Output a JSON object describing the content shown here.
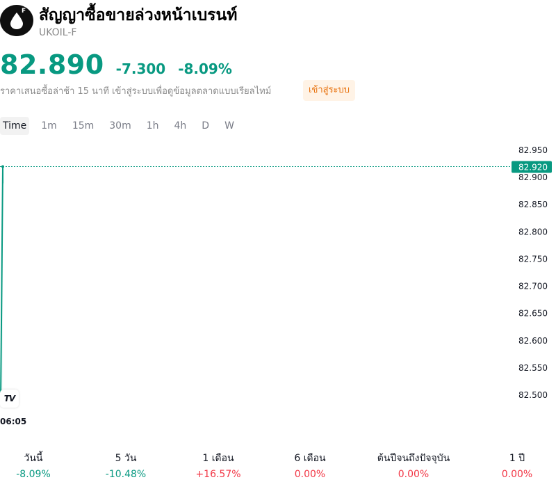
{
  "header": {
    "logo_badge": "F",
    "title": "สัญญาซื้อขายล่วงหน้าเบรนท์",
    "ticker": "UKOIL-F",
    "price": "82.890",
    "change": "-7.300",
    "change_pct": "-8.09%",
    "notice": "ราคาเสนอซื้อล่าช้า 15 นาที เข้าสู่ระบบเพื่อดูข้อมูลตลาดแบบเรียลไทม์",
    "login_label": "เข้าสู่ระบบ"
  },
  "colors": {
    "up": "#089981",
    "down": "#f23645",
    "accent_orange": "#e8700a"
  },
  "tabs": [
    {
      "label": "Time",
      "active": true
    },
    {
      "label": "1m"
    },
    {
      "label": "15m"
    },
    {
      "label": "30m"
    },
    {
      "label": "1h"
    },
    {
      "label": "4h"
    },
    {
      "label": "D"
    },
    {
      "label": "W"
    }
  ],
  "chart": {
    "logo_text": "TV",
    "time_label": "06:05",
    "last_price_label": "82.920",
    "icons": {
      "logo": "oil-drop-icon",
      "watermark": "tradingview-logo-icon"
    }
  },
  "chart_data": {
    "type": "area",
    "x": [
      "06:05",
      "06:05"
    ],
    "y": [
      82.49,
      82.92
    ],
    "ylim": [
      82.47,
      82.97
    ],
    "y_ticks": [
      "82.950",
      "82.900",
      "82.850",
      "82.800",
      "82.750",
      "82.700",
      "82.650",
      "82.600",
      "82.550",
      "82.500"
    ],
    "last_value": 82.92,
    "grid": false
  },
  "performance": [
    {
      "label": "วันนี้",
      "value": "-8.09%",
      "dir": "up"
    },
    {
      "label": "5 วัน",
      "value": "-10.48%",
      "dir": "up"
    },
    {
      "label": "1 เดือน",
      "value": "+16.57%",
      "dir": "down"
    },
    {
      "label": "6 เดือน",
      "value": "0.00%",
      "dir": "down"
    },
    {
      "label": "ต้นปีจนถึงปัจจุบัน",
      "value": "0.00%",
      "dir": "down"
    },
    {
      "label": "1 ปี",
      "value": "0.00%",
      "dir": "down"
    }
  ]
}
